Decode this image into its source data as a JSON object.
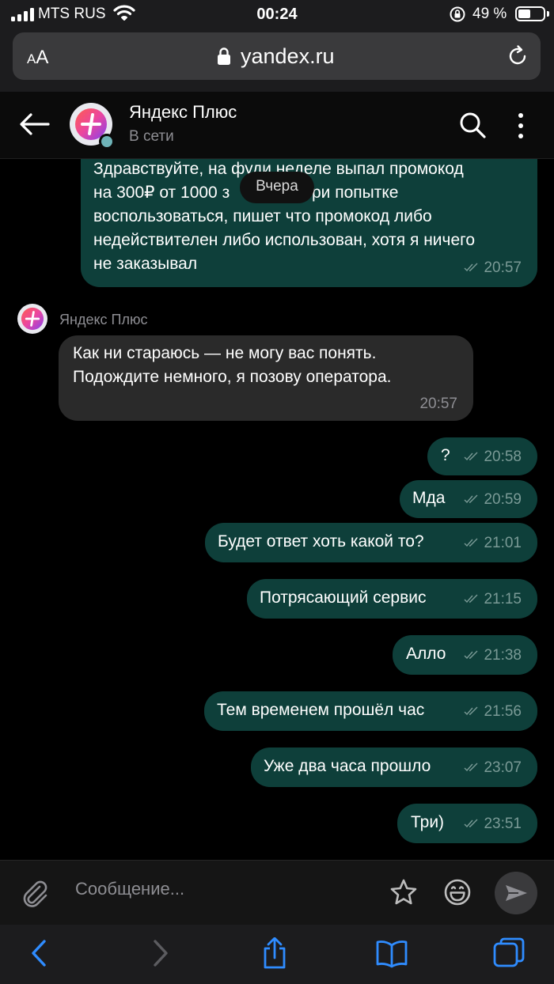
{
  "status_bar": {
    "carrier": "MTS RUS",
    "time": "00:24",
    "battery": "49 %",
    "battery_level": 0.49
  },
  "browser": {
    "text_size": "AA",
    "url": "yandex.ru"
  },
  "chat_header": {
    "name": "Яндекс Плюс",
    "status": "В сети"
  },
  "date_separator": "Вчера",
  "first_message": {
    "lines": [
      "Здравствуйте, на фуди неделе выпал промокод",
      "на 300₽ от 1000 з",
      "ри попытке",
      "воспользоваться, пишет что промокод либо",
      "недействителен либо использован, хотя я ничего",
      "не заказывал"
    ],
    "time": "20:57"
  },
  "bot_message": {
    "sender": "Яндекс Плюс",
    "lines": [
      "Как ни стараюсь — не могу вас понять.",
      "Подождите немного, я позову оператора."
    ],
    "time": "20:57"
  },
  "messages": [
    {
      "text": "?",
      "time": "20:58"
    },
    {
      "text": "Мда",
      "time": "20:59"
    },
    {
      "text": "Будет ответ хоть какой то?",
      "time": "21:01"
    },
    {
      "text": "Потрясающий сервис",
      "time": "21:15"
    },
    {
      "text": "Алло",
      "time": "21:38"
    },
    {
      "text": "Тем временем прошёл час",
      "time": "21:56"
    },
    {
      "text": "Уже два часа прошло",
      "time": "23:07"
    },
    {
      "text": "Три)",
      "time": "23:51"
    }
  ],
  "composer": {
    "placeholder": "Сообщение..."
  },
  "colors": {
    "outgoing_bubble": "#0e3f3a",
    "incoming_bubble": "#2a2a2a",
    "background": "#000000"
  },
  "icons": [
    "signal-icon",
    "wifi-icon",
    "rotation-lock-icon",
    "battery-icon",
    "lock-icon",
    "reload-icon",
    "back-arrow-icon",
    "search-icon",
    "more-icon",
    "read-ticks-icon",
    "attach-icon",
    "star-icon",
    "emoji-icon",
    "send-icon",
    "safari-back-icon",
    "safari-forward-icon",
    "share-icon",
    "bookmarks-icon",
    "tabs-icon"
  ]
}
